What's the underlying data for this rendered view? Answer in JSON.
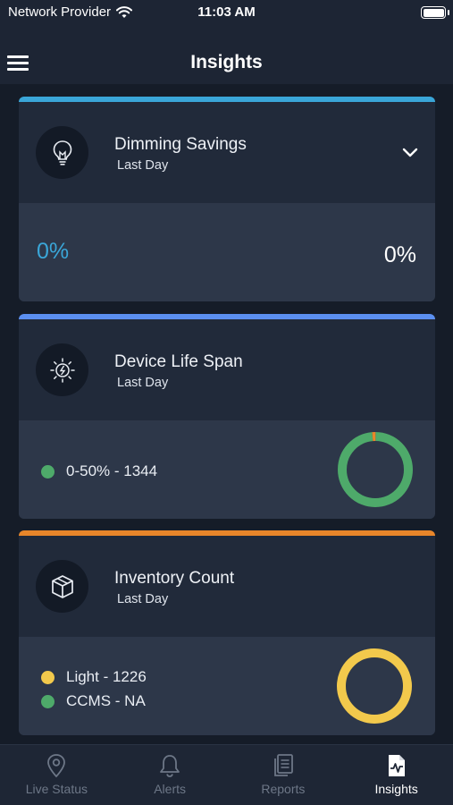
{
  "status_bar": {
    "carrier": "Network Provider",
    "time": "11:03 AM"
  },
  "header": {
    "title": "Insights"
  },
  "cards": [
    {
      "title": "Dimming Savings",
      "subtitle": "Last Day",
      "accent_color": "#3aa6d8",
      "value_left": "0%",
      "value_right": "0%",
      "expanded": true
    },
    {
      "title": "Device Life Span",
      "subtitle": "Last Day",
      "accent_color": "#5b8ff0",
      "legend": [
        {
          "label": "0-50% - 1344",
          "color": "#4eaa6a"
        }
      ],
      "donut": [
        {
          "label": "0-50%",
          "value": 1344,
          "color": "#4eaa6a"
        },
        {
          "label": "other",
          "value": 20,
          "color": "#e8862a"
        }
      ]
    },
    {
      "title": "Inventory Count",
      "subtitle": "Last Day",
      "accent_color": "#e8862a",
      "legend": [
        {
          "label": "Light - 1226",
          "color": "#f2c94c"
        },
        {
          "label": "CCMS - NA",
          "color": "#4eaa6a"
        }
      ],
      "donut": [
        {
          "label": "Light",
          "value": 1226,
          "color": "#f2c94c"
        }
      ]
    }
  ],
  "tabs": [
    {
      "label": "Live Status",
      "icon": "location-pin-icon",
      "active": false
    },
    {
      "label": "Alerts",
      "icon": "bell-icon",
      "active": false
    },
    {
      "label": "Reports",
      "icon": "reports-icon",
      "active": false
    },
    {
      "label": "Insights",
      "icon": "insights-icon",
      "active": true
    }
  ],
  "colors": {
    "inactive_tab": "#6d7787",
    "active_tab": "#ffffff",
    "percent_blue": "#3aa6d8"
  }
}
